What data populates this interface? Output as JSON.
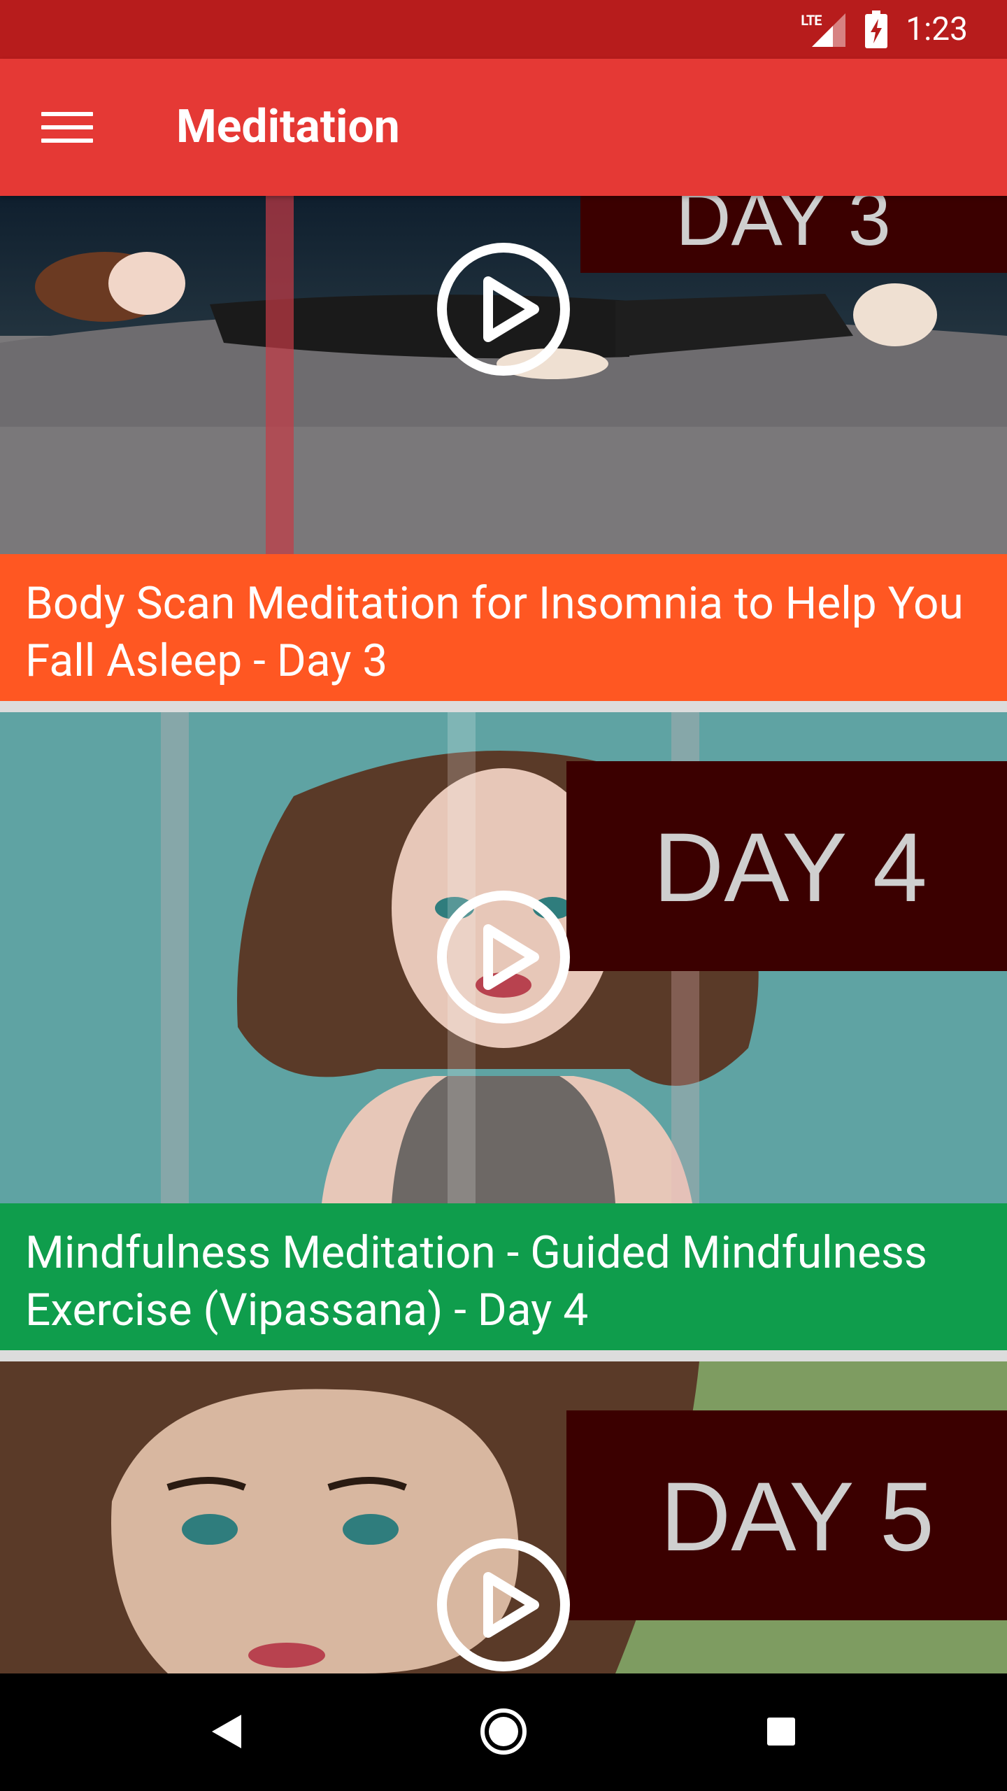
{
  "status_bar": {
    "network": "LTE",
    "time": "1:23"
  },
  "app_bar": {
    "title": "Meditation",
    "menu_icon": "hamburger-menu-icon"
  },
  "videos": [
    {
      "title": "Body Scan Meditation for Insomnia to Help You Fall Asleep - Day 3",
      "thumbnail_text": "DAY 3",
      "color": "#ff5722"
    },
    {
      "title": "Mindfulness Meditation - Guided Mindfulness Exercise (Vipassana) - Day 4",
      "thumbnail_text": "DAY 4",
      "color": "#0f9d4c"
    },
    {
      "title": "",
      "thumbnail_text": "DAY 5",
      "color": ""
    }
  ],
  "nav_bar": {
    "back_icon": "back-triangle-icon",
    "home_icon": "home-circle-icon",
    "recents_icon": "recents-square-icon"
  },
  "colors": {
    "status_bar": "#b71c1c",
    "app_bar": "#e53935",
    "nav_bar": "#000000"
  }
}
